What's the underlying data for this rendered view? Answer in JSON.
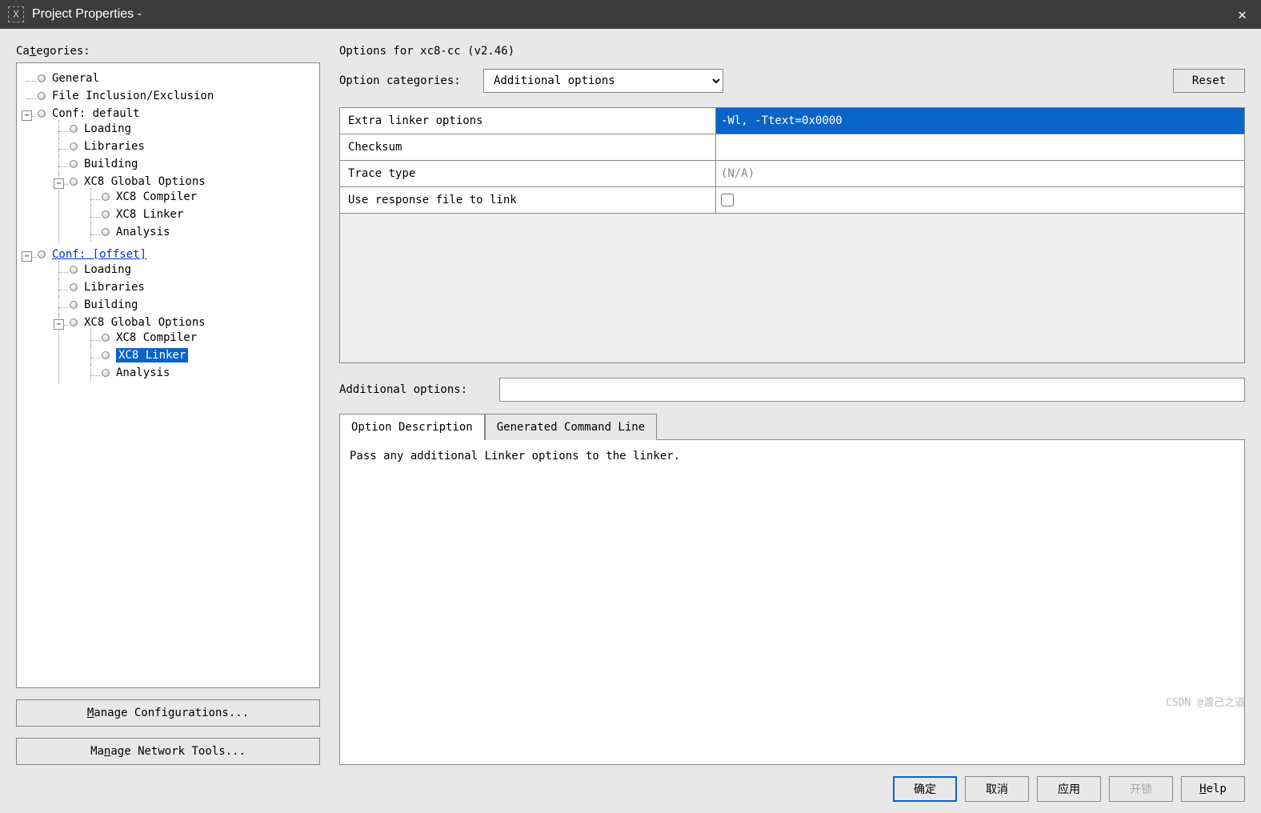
{
  "window": {
    "title": "Project Properties - "
  },
  "left": {
    "label": "Categories:",
    "manage_conf": "Manage Configurations...",
    "manage_net": "Manage Network Tools...",
    "tree": {
      "general": "General",
      "file_incl": "File Inclusion/Exclusion",
      "conf_default": "Conf: default",
      "loading": "Loading",
      "libraries": "Libraries",
      "building": "Building",
      "xc8_global": "XC8 Global Options",
      "xc8_compiler": "XC8 Compiler",
      "xc8_linker": "XC8 Linker",
      "analysis": "Analysis",
      "conf_offset": "Conf: [offset]"
    }
  },
  "right": {
    "title": "Options for xc8-cc (v2.46)",
    "cat_label": "Option categories:",
    "cat_value": "Additional options",
    "reset": "Reset",
    "rows": {
      "extra_linker": {
        "k": "Extra linker options",
        "v": "-Wl, -Ttext=0x0000"
      },
      "checksum": {
        "k": "Checksum",
        "v": ""
      },
      "trace": {
        "k": "Trace type",
        "v": "(N/A)"
      },
      "use_resp": {
        "k": "Use response file to link"
      }
    },
    "add_label": "Additional options:",
    "add_value": "",
    "tab_desc": "Option Description",
    "tab_cmd": "Generated Command Line",
    "desc_text": "Pass any additional Linker options to the linker."
  },
  "footer": {
    "ok": "确定",
    "cancel": "取消",
    "apply": "应用",
    "unlock": "开锁",
    "help": "Help"
  },
  "watermark": "CSDN @渡己之道"
}
